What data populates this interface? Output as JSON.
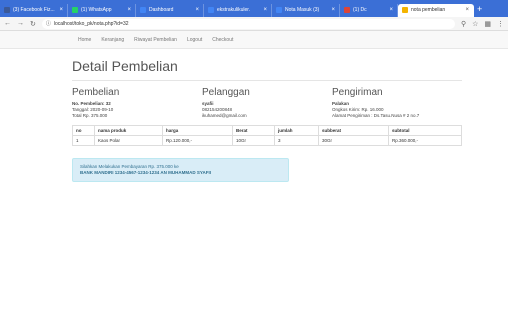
{
  "browser": {
    "tabs": [
      {
        "label": "(3) Facebook Fiz...",
        "color": "#3b5998"
      },
      {
        "label": "(1) WhatsApp",
        "color": "#25d366"
      },
      {
        "label": "Dashboard",
        "color": "#4285f4"
      },
      {
        "label": "ekstrakulikuler.",
        "color": "#4285f4"
      },
      {
        "label": "Nota Masuk (3)",
        "color": "#4285f4"
      },
      {
        "label": "(1) Dc",
        "color": "#db4437"
      },
      {
        "label": "nota pembelian",
        "color": "#f4b400"
      }
    ],
    "new_tab": "+",
    "url": "localhost/toko_pk/nota.php?id=32"
  },
  "nav": {
    "items": [
      "Home",
      "Keranjang",
      "Riwayat Pembelian",
      "Logout",
      "Checkout"
    ]
  },
  "page": {
    "title": "Detail Pembelian",
    "pembelian": {
      "heading": "Pembelian",
      "no": "No. Pembelian: 32",
      "tanggal": "Tanggal: 2020-09-10",
      "total": "Total Rp. 375.000"
    },
    "pelanggan": {
      "heading": "Pelanggan",
      "nama": "syafii",
      "telepon": "082154200848",
      "email": "ikuhamed@gmail.com"
    },
    "pengiriman": {
      "heading": "Pengiriman",
      "tipe": "Palakan",
      "ongkos": "Ongkos Kirim: Rp. 16.000",
      "alamat": "Alamat Pengiriman : Ds.Tasu.Nusa # 2 no.7"
    },
    "table": {
      "headers": [
        "no",
        "nama produk",
        "harga",
        "Berat",
        "jumlah",
        "subberat",
        "subtotal"
      ],
      "rows": [
        [
          "1",
          "Kaos Polar",
          "Rp.120.000,-",
          "10Gr",
          "3",
          "30Gr",
          "Rp.360.000,-"
        ]
      ]
    },
    "alert": {
      "line1": "Silahkan Melakukan Pembayaran Rp. 375.000 ke",
      "line2": "BANK MANDIRI 1234-4567-1234-1234 AN MUHAMMAD SYAFII"
    }
  }
}
